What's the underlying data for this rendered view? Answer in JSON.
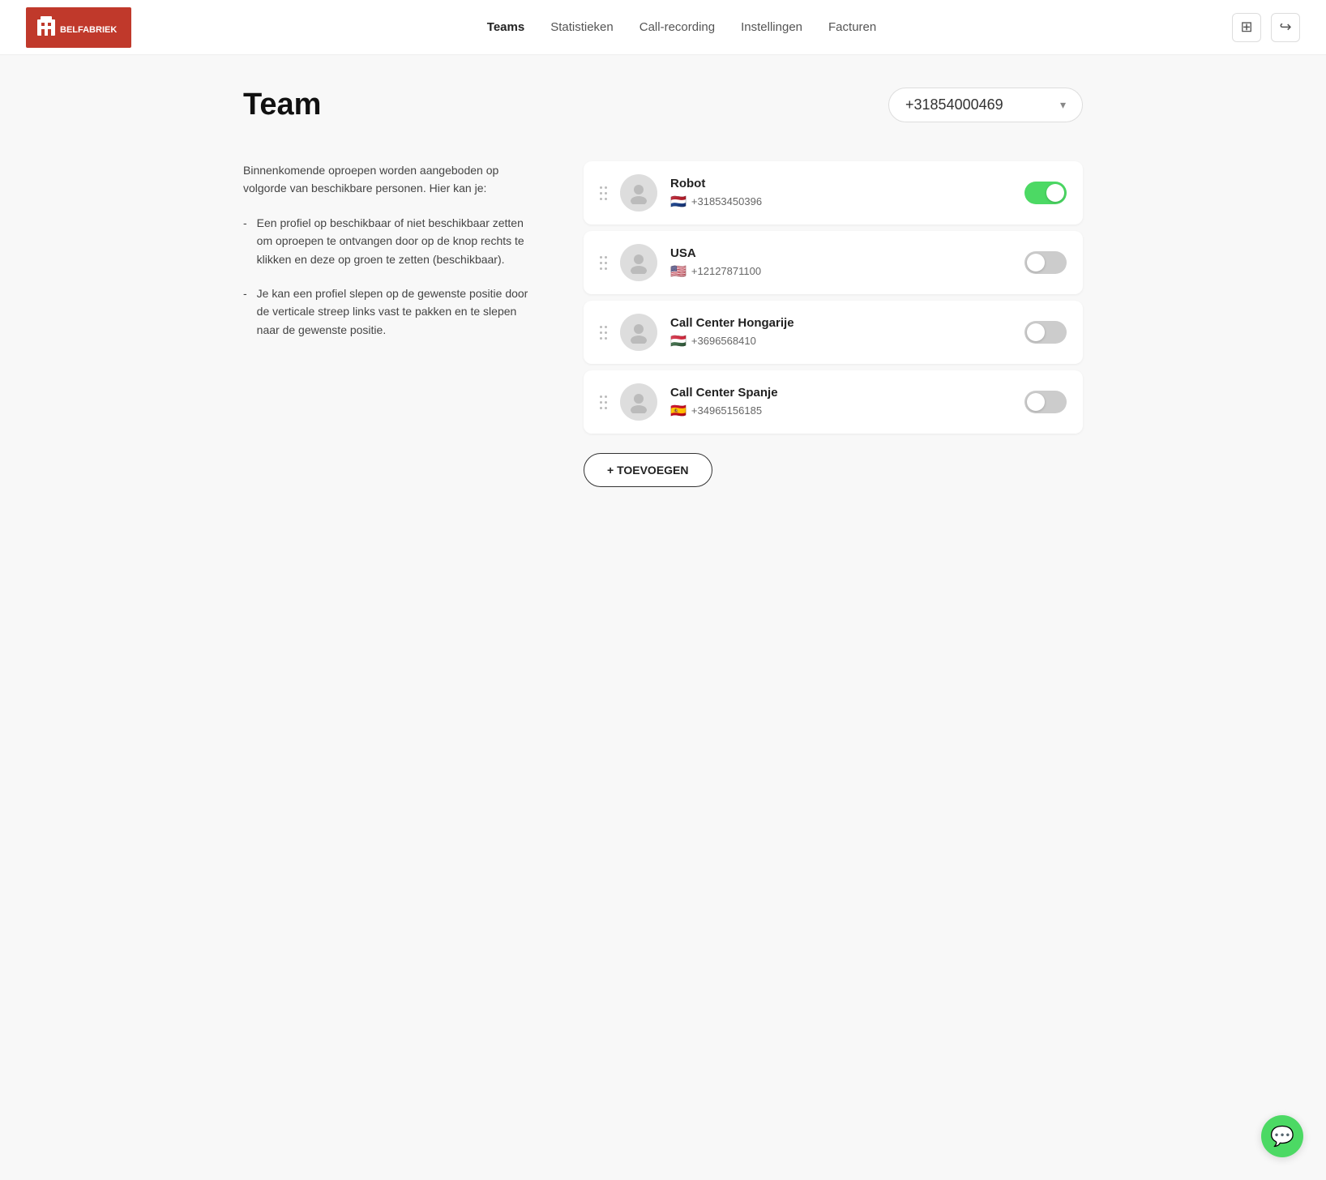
{
  "header": {
    "logo_alt": "Belfabriek",
    "nav": [
      {
        "label": "Teams",
        "active": true
      },
      {
        "label": "Statistieken",
        "active": false
      },
      {
        "label": "Call-recording",
        "active": false
      },
      {
        "label": "Instellingen",
        "active": false
      },
      {
        "label": "Facturen",
        "active": false
      }
    ],
    "icon_building": "🏢",
    "icon_exit": "➡"
  },
  "page": {
    "title": "Team",
    "phone_selector": {
      "value": "+31854000469",
      "chevron": "▾"
    }
  },
  "instructions": {
    "intro": "Binnenkomende oproepen worden aangeboden op volgorde van beschikbare personen. Hier kan je:",
    "bullets": [
      "Een profiel op beschikbaar of niet beschikbaar zetten om oproepen te ontvangen door op de knop rechts te klikken en deze op groen te zetten (beschikbaar).",
      "Je kan een profiel slepen op de gewenste positie door de verticale streep links vast te pakken en te slepen naar de gewenste positie."
    ]
  },
  "team_members": [
    {
      "name": "Robot",
      "phone": "+31853450396",
      "flag": "🇳🇱",
      "enabled": true
    },
    {
      "name": "USA",
      "phone": "+12127871100",
      "flag": "🇺🇸",
      "enabled": false
    },
    {
      "name": "Call Center Hongarije",
      "phone": "+3696568410",
      "flag": "🇭🇺",
      "enabled": false
    },
    {
      "name": "Call Center Spanje",
      "phone": "+34965156185",
      "flag": "🇪🇸",
      "enabled": false
    }
  ],
  "add_button": {
    "label": "+ TOEVOEGEN"
  },
  "tooltip": {
    "text": "Ups_logo.png"
  }
}
